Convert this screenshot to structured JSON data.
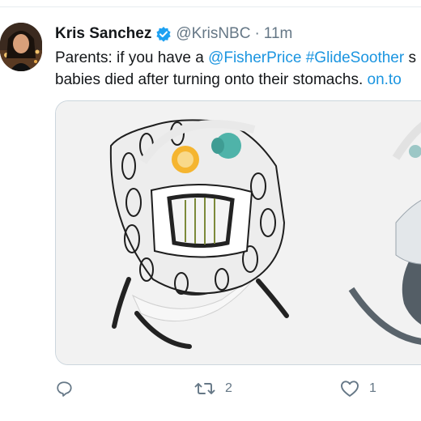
{
  "tweet": {
    "display_name": "Kris Sanchez",
    "handle": "@KrisNBC",
    "separator": "·",
    "time": "11m",
    "text": {
      "line1_prefix": "Parents: if you have a ",
      "mention": "@FisherPrice",
      "space": " ",
      "hashtag": "#GlideSoother",
      "line1_suffix": " s",
      "line2_prefix": "babies died after turning onto their stomachs. ",
      "link": "on.to"
    },
    "actions": {
      "reply_count": "",
      "retweet_count": "2",
      "like_count": "1"
    }
  },
  "colors": {
    "link": "#1b95e0",
    "verified": "#1da1f2",
    "secondary": "#657786"
  },
  "icons": {
    "verified": "verified-badge-icon",
    "reply": "reply-icon",
    "retweet": "retweet-icon",
    "like": "heart-icon"
  }
}
